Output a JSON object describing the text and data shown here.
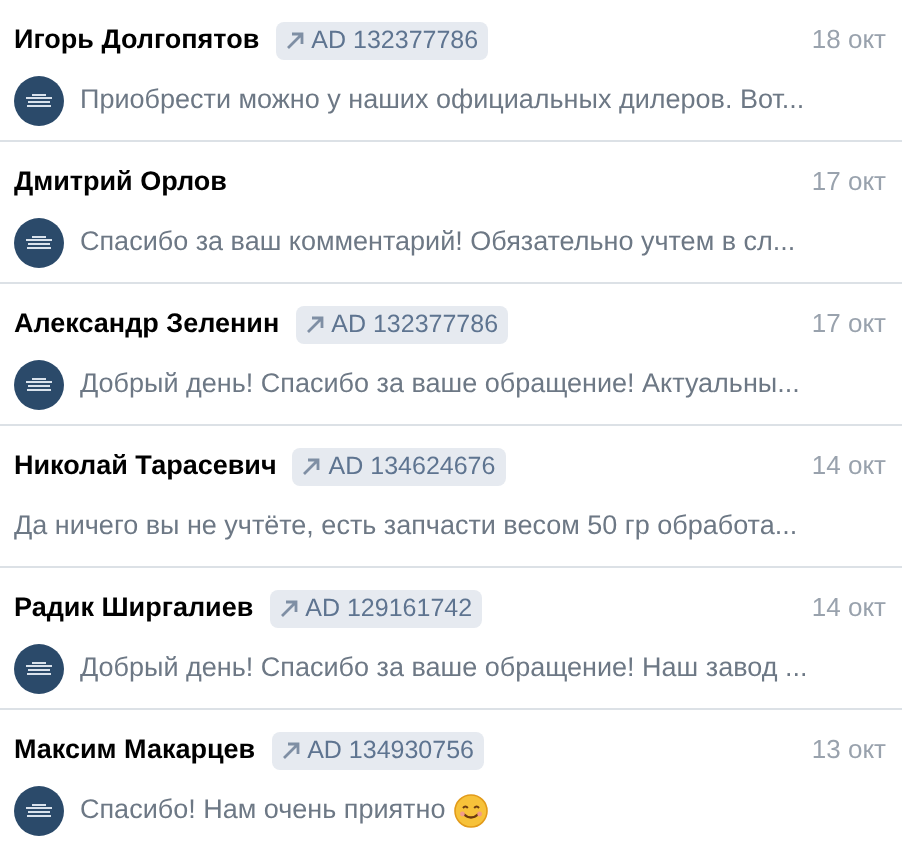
{
  "dialogs": [
    {
      "name": "Игорь Долгопятов",
      "ad": "AD 132377786",
      "date": "18 окт",
      "page_avatar": true,
      "preview": "Приобрести можно у наших официальных дилеров. Вот...",
      "smile_emoji": false
    },
    {
      "name": "Дмитрий Орлов",
      "date": "17 окт",
      "page_avatar": true,
      "preview": "Спасибо за ваш комментарий! Обязательно учтем в сл...",
      "smile_emoji": false
    },
    {
      "name": "Александр Зеленин",
      "ad": "AD 132377786",
      "date": "17 окт",
      "page_avatar": true,
      "preview": "Добрый день! Спасибо за ваше обращение! Актуальны...",
      "smile_emoji": false
    },
    {
      "name": "Николай Тарасевич",
      "ad": "AD 134624676",
      "date": "14 окт",
      "page_avatar": false,
      "preview": "Да ничего вы не учтёте, есть запчасти весом 50 гр обработа...",
      "smile_emoji": false
    },
    {
      "name": "Радик Ширгалиев",
      "ad": "AD 129161742",
      "date": "14 окт",
      "page_avatar": true,
      "preview": "Добрый день! Спасибо за ваше обращение! Наш завод ...",
      "smile_emoji": false
    },
    {
      "name": "Максим Макарцев",
      "ad": "AD 134930756",
      "date": "13 окт",
      "page_avatar": true,
      "preview": "Спасибо! Нам очень приятно",
      "smile_emoji": true
    }
  ]
}
